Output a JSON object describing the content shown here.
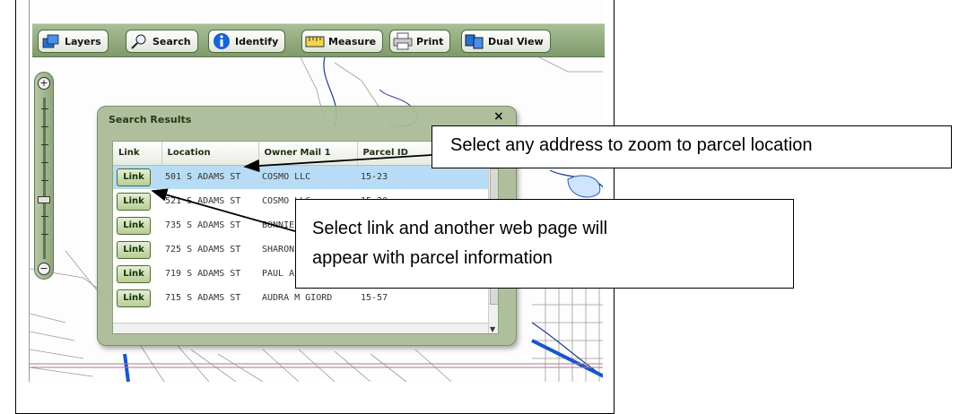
{
  "toolbar": {
    "buttons": [
      {
        "label": "Layers",
        "icon": "layers-icon"
      },
      {
        "label": "Search",
        "icon": "magnifier-icon"
      },
      {
        "label": "Identify",
        "icon": "info-icon"
      },
      {
        "label": "Measure",
        "icon": "ruler-icon"
      },
      {
        "label": "Print",
        "icon": "printer-icon"
      },
      {
        "label": "Dual View",
        "icon": "dual-view-icon"
      }
    ]
  },
  "zoom": {
    "in_label": "+",
    "out_label": "−"
  },
  "search_results": {
    "title": "Search Results",
    "close_label": "×",
    "columns": [
      "Link",
      "Location",
      "Owner Mail 1",
      "Parcel ID"
    ],
    "link_label": "Link",
    "rows": [
      {
        "location": "501 S ADAMS ST",
        "owner": "COSMO LLC",
        "parcel": "15-23",
        "selected": true
      },
      {
        "location": "521 S ADAMS ST",
        "owner": "COSMO LLC",
        "parcel": "15-20",
        "selected": false
      },
      {
        "location": "735 S ADAMS ST",
        "owner": "BONNIE",
        "parcel": "",
        "selected": false
      },
      {
        "location": "725 S ADAMS ST",
        "owner": "SHARON",
        "parcel": "",
        "selected": false
      },
      {
        "location": "719 S ADAMS ST",
        "owner": "PAUL A",
        "parcel": "",
        "selected": false
      },
      {
        "location": "715 S ADAMS ST",
        "owner": "AUDRA M GIORD",
        "parcel": "15-57",
        "selected": false
      }
    ]
  },
  "callouts": {
    "address": "Select any address to zoom to parcel location",
    "link_line1": "Select link and another web page will",
    "link_line2": "appear with parcel information"
  }
}
